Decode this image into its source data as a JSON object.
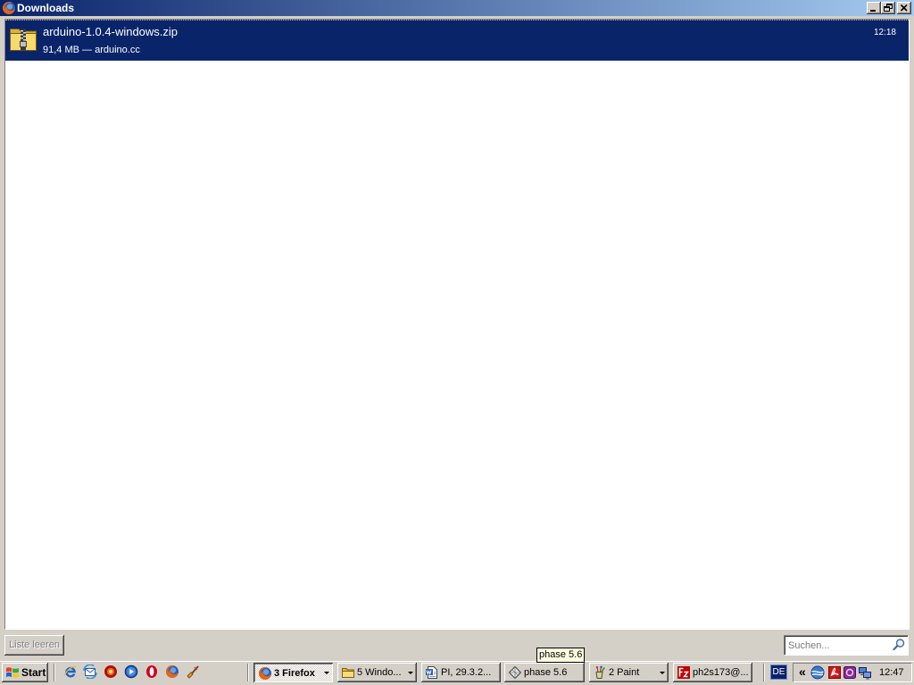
{
  "window": {
    "title": "Downloads",
    "icon": "firefox-icon",
    "controls": [
      "minimize-icon",
      "restore-icon",
      "close-icon"
    ]
  },
  "downloads": {
    "items": [
      {
        "file_name": "arduino-1.0.4-windows.zip",
        "details": "91,4 MB — arduino.cc",
        "time": "12:18",
        "icon": "zip-folder-icon",
        "selected": true
      }
    ],
    "clear_button": {
      "label": "Liste leeren",
      "enabled": false
    },
    "search": {
      "placeholder": "Suchen...",
      "value": "",
      "icon": "magnifier-icon"
    }
  },
  "tooltip": {
    "text": "phase 5.6"
  },
  "taskbar": {
    "start_label": "Start",
    "start_icon": "windows-flag-icon",
    "quick_launch": [
      "internet-explorer-icon",
      "outlook-express-icon",
      "red-circle-app-icon",
      "media-player-icon",
      "opera-icon",
      "firefox-icon",
      "brush-tool-icon"
    ],
    "tasks": [
      {
        "label": "3 Firefox",
        "icon": "firefox-icon",
        "pressed": true,
        "has_menu": true
      },
      {
        "label": "5 Windo...",
        "icon": "folder-icon",
        "pressed": false,
        "has_menu": true
      },
      {
        "label": "PI, 29.3.2...",
        "icon": "word-document-icon",
        "pressed": false,
        "has_menu": false
      },
      {
        "label": "phase 5.6",
        "icon": "diamond-app-icon",
        "pressed": false,
        "has_menu": false
      },
      {
        "label": "2 Paint",
        "icon": "paint-icon",
        "pressed": false,
        "has_menu": true
      },
      {
        "label": "ph2s173@...",
        "icon": "filezilla-icon",
        "pressed": false,
        "has_menu": false
      }
    ],
    "language": "DE",
    "tray": {
      "expand_glyph": "«",
      "icons": [
        "network-globe-icon",
        "acrobat-icon",
        "purple-app-icon",
        "network-computers-icon"
      ],
      "clock": "12:47"
    }
  },
  "colors": {
    "title_gradient_start": "#0A246A",
    "title_gradient_end": "#A6CAF0",
    "selection": "#0A246A",
    "face": "#D4D0C8",
    "tooltip_bg": "#FFFFE1",
    "language_bg": "#0A246A"
  }
}
